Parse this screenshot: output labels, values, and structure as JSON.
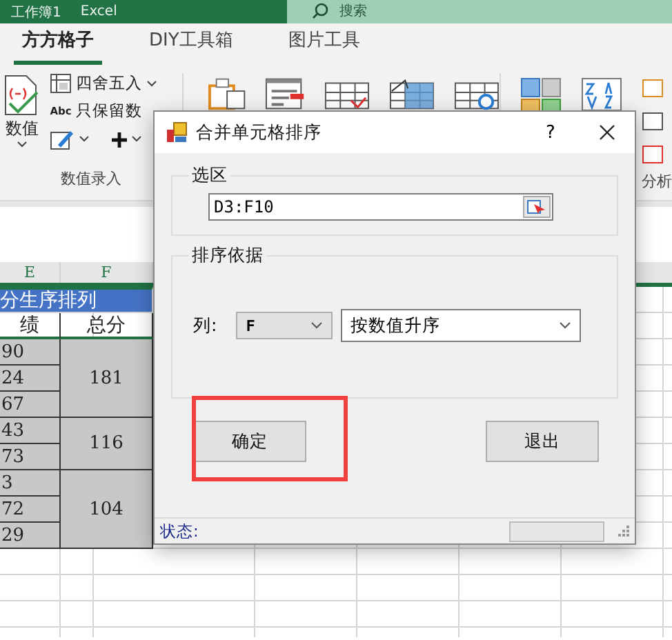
{
  "app_bar": {
    "title": "工作簿1",
    "app": "Excel",
    "search": {
      "placeholder": "搜索"
    }
  },
  "ribbon_tabs": [
    {
      "label": "方方格子",
      "selected": true
    },
    {
      "label": "DIY工具箱",
      "selected": false
    },
    {
      "label": "图片工具",
      "selected": false
    }
  ],
  "ribbon": {
    "big_button": {
      "label": "数值"
    },
    "small_buttons": [
      {
        "kind": "dropdown",
        "label": "四舍五入"
      },
      {
        "kind": "plain",
        "icon_text": "Abc",
        "label": "只保留数"
      }
    ],
    "group_label": "数值录入",
    "right_group_label": "分析"
  },
  "sheet": {
    "columns": [
      "E",
      "F"
    ],
    "title_row": "分生序排列",
    "header_row": [
      "绩",
      "总分"
    ],
    "groups": [
      {
        "total": "181",
        "scores": [
          "90",
          "24",
          "67"
        ]
      },
      {
        "total": "116",
        "scores": [
          "43",
          "73"
        ]
      },
      {
        "total": "104",
        "scores": [
          "3",
          "72",
          "29"
        ]
      }
    ]
  },
  "dialog": {
    "title": "合并单元格排序",
    "help": "?",
    "selection_group": {
      "legend": "选区",
      "value": "D3:F10"
    },
    "sort_group": {
      "legend": "排序依据",
      "column_label": "列:",
      "column_value": "F",
      "order_value": "按数值升序"
    },
    "buttons": [
      {
        "label": "确定",
        "highlighted": true
      },
      {
        "label": "退出",
        "highlighted": false
      }
    ],
    "status_label": "状态:",
    "progress": {
      "level": 0
    }
  }
}
